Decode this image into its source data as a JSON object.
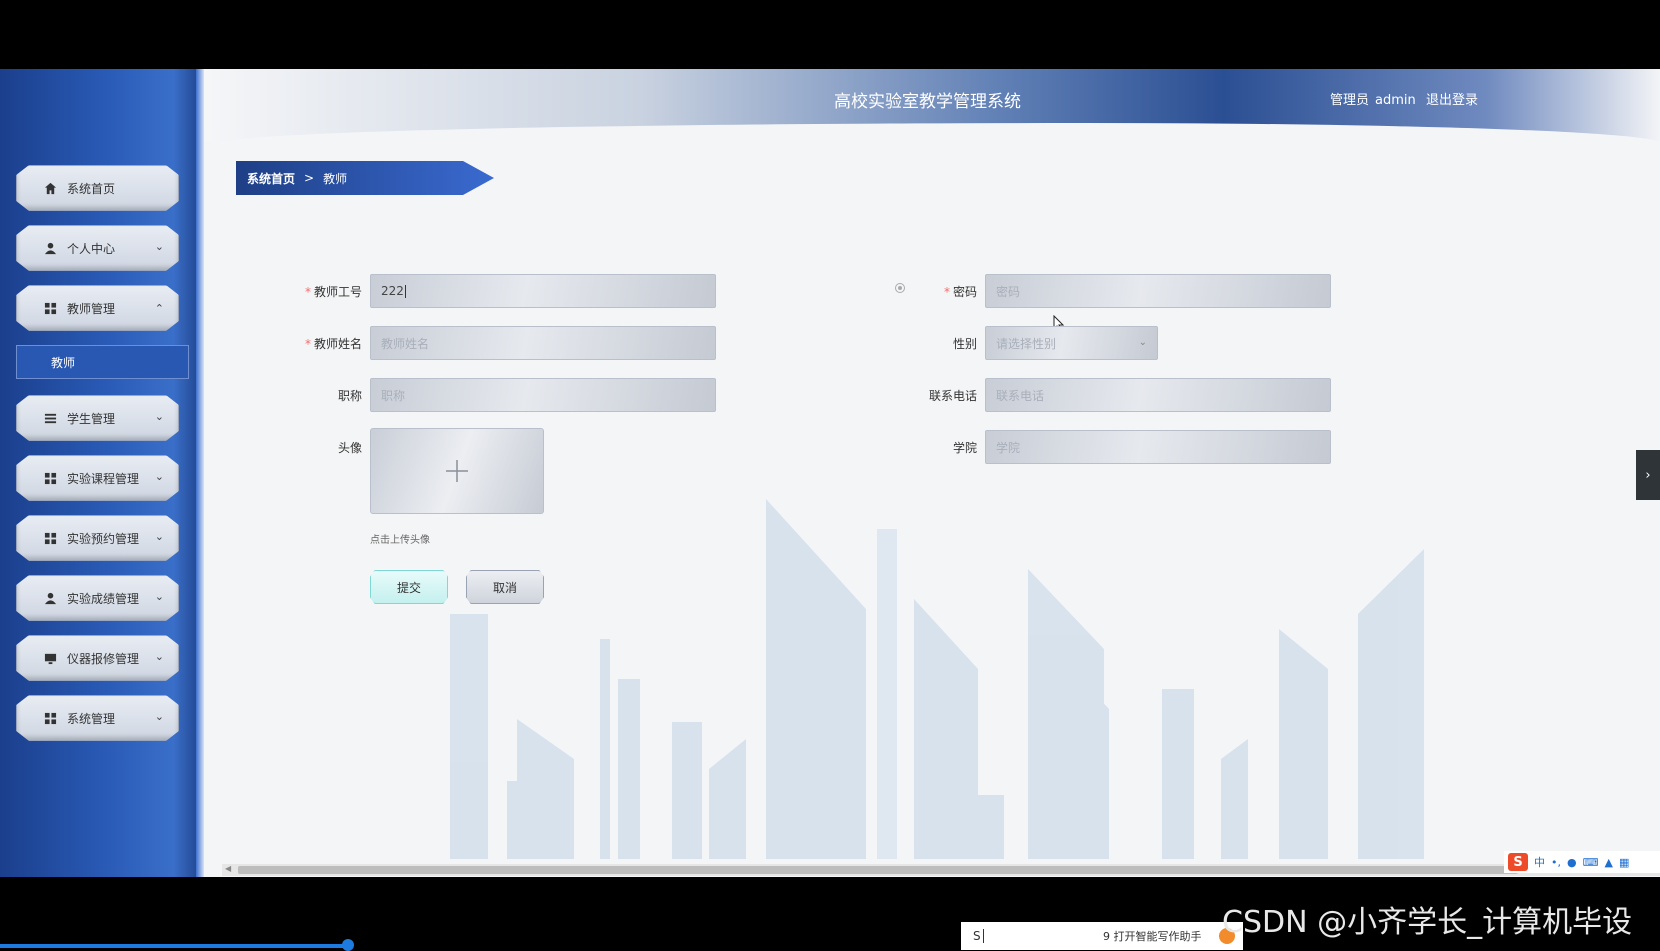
{
  "app": {
    "title": "高校实验室教学管理系统",
    "user_role": "管理员",
    "user_name": "admin",
    "logout_label": "退出登录"
  },
  "sidebar": {
    "items": [
      {
        "label": "系统首页",
        "icon": "home-icon",
        "has_chevron": false
      },
      {
        "label": "个人中心",
        "icon": "user-icon",
        "has_chevron": true,
        "chevron": "down"
      },
      {
        "label": "教师管理",
        "icon": "grid-icon",
        "has_chevron": true,
        "chevron": "up"
      },
      {
        "label": "学生管理",
        "icon": "list-icon",
        "has_chevron": true,
        "chevron": "down"
      },
      {
        "label": "实验课程管理",
        "icon": "grid-icon",
        "has_chevron": true,
        "chevron": "down"
      },
      {
        "label": "实验预约管理",
        "icon": "grid-icon",
        "has_chevron": true,
        "chevron": "down"
      },
      {
        "label": "实验成绩管理",
        "icon": "user-icon",
        "has_chevron": true,
        "chevron": "down"
      },
      {
        "label": "仪器报修管理",
        "icon": "monitor-icon",
        "has_chevron": true,
        "chevron": "down"
      },
      {
        "label": "系统管理",
        "icon": "grid-icon",
        "has_chevron": true,
        "chevron": "down"
      }
    ],
    "sub_item": "教师"
  },
  "breadcrumb": {
    "home": "系统首页",
    "separator": ">",
    "current": "教师"
  },
  "form": {
    "teacher_id": {
      "label": "教师工号",
      "required": true,
      "value": "222"
    },
    "password": {
      "label": "密码",
      "required": true,
      "placeholder": "密码"
    },
    "teacher_name": {
      "label": "教师姓名",
      "required": true,
      "placeholder": "教师姓名"
    },
    "gender": {
      "label": "性别",
      "placeholder": "请选择性别"
    },
    "title": {
      "label": "职称",
      "placeholder": "职称"
    },
    "phone": {
      "label": "联系电话",
      "placeholder": "联系电话"
    },
    "avatar": {
      "label": "头像",
      "hint": "点击上传头像"
    },
    "college": {
      "label": "学院",
      "placeholder": "学院"
    },
    "submit_label": "提交",
    "cancel_label": "取消"
  },
  "ime": {
    "lang": "中"
  },
  "taskbar": {
    "input_value": "S",
    "assistant_text": "9 打开智能写作助手"
  },
  "watermark": "CSDN @小齐学长_计算机毕设",
  "colors": {
    "sidebar_blue": "#2a5cb8",
    "breadcrumb_blue": "#1e3f86",
    "required_red": "#f56c6c",
    "submit_teal": "#7fd8d4"
  }
}
